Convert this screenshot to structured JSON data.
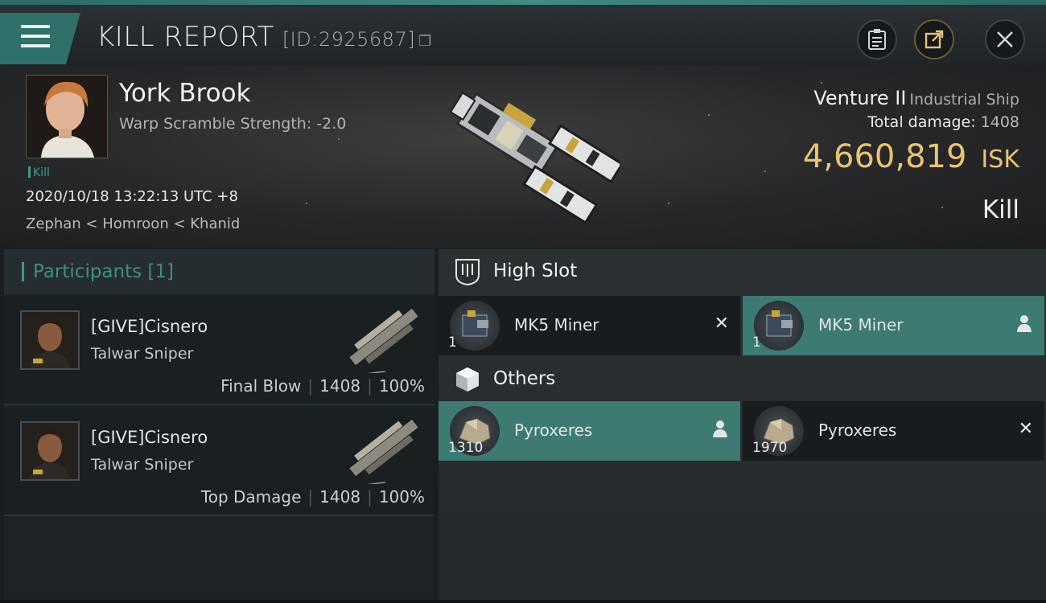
{
  "header": {
    "title": "KILL REPORT",
    "id_label": "[ID:2925687]"
  },
  "victim": {
    "name": "York Brook",
    "warp_scramble": "Warp Scramble Strength: -2.0",
    "tag": "Kill",
    "datetime": "2020/10/18 13:22:13 UTC +8",
    "location": "Zephan < Homroon < Khanid",
    "ship_name": "Venture II",
    "ship_class": "Industrial Ship",
    "total_damage_label": "Total damage:",
    "total_damage": "1408",
    "isk_value": "4,660,819",
    "isk_unit": "ISK",
    "result": "Kill"
  },
  "participants": {
    "title": "Participants [1]",
    "rows": [
      {
        "name": "[GIVE]Cisnero",
        "ship": "Talwar Sniper",
        "role": "Final Blow",
        "damage": "1408",
        "percent": "100%"
      },
      {
        "name": "[GIVE]Cisnero",
        "ship": "Talwar Sniper",
        "role": "Top Damage",
        "damage": "1408",
        "percent": "100%"
      }
    ]
  },
  "modules": {
    "high_slot_title": "High Slot",
    "others_title": "Others",
    "high_slot": [
      {
        "name": "MK5 Miner",
        "qty": "1",
        "status": "destroyed"
      },
      {
        "name": "MK5 Miner",
        "qty": "1",
        "status": "dropped"
      }
    ],
    "others": [
      {
        "name": "Pyroxeres",
        "qty": "1310",
        "status": "dropped"
      },
      {
        "name": "Pyroxeres",
        "qty": "1970",
        "status": "destroyed"
      }
    ]
  },
  "colors": {
    "accent_teal": "#3d7a72",
    "isk_gold": "#e9c372"
  }
}
